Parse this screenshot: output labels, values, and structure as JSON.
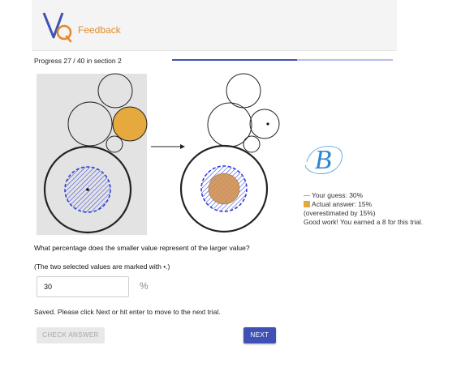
{
  "header": {
    "title": "Feedback",
    "logo_letters": "VQ",
    "accent_color": "#e38b2d"
  },
  "progress": {
    "text": "Progress 27 / 40 in section 2",
    "fraction": 0.565
  },
  "feedback": {
    "grade_letter": "B",
    "guess_line": "Your guess: 30%",
    "actual_line": "Actual answer: 15%",
    "diff_line": "(overestimated by 15%)",
    "result_line": "Good work! You earned a 8 for this trial."
  },
  "question": {
    "text": "What percentage does the smaller value represent of the larger value?",
    "hint": "(The two selected values are marked with •.)"
  },
  "answer": {
    "value": "30",
    "unit": "%"
  },
  "status_text": "Saved. Please click Next or hit enter to move to the next trial.",
  "buttons": {
    "check_answer": "CHECK ANSWER",
    "next": "NEXT"
  },
  "colors": {
    "primary": "#3f51b5",
    "guess_hatch": "#2f3fd8",
    "actual_fill": "#e6a93e",
    "stimulus_bg": "#e3e3e3"
  }
}
